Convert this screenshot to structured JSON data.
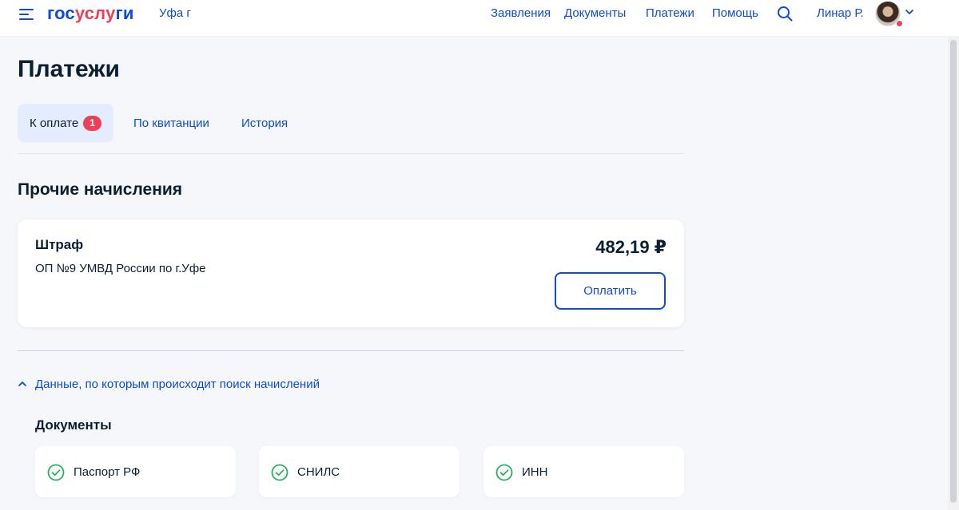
{
  "header": {
    "logo_part1": "гос",
    "logo_part2": "услу",
    "logo_part3": "ги",
    "city": "Уфа г",
    "nav": [
      "Заявления",
      "Документы",
      "Платежи",
      "Помощь"
    ],
    "user_name": "Линар Р."
  },
  "page": {
    "title": "Платежи",
    "tabs": [
      {
        "label": "К оплате",
        "badge": "1"
      },
      {
        "label": "По квитанции"
      },
      {
        "label": "История"
      }
    ]
  },
  "charges": {
    "section_title": "Прочие начисления",
    "item": {
      "title": "Штраф",
      "issuer": "ОП №9 УМВД России по г.Уфе",
      "amount": "482,19 ₽",
      "pay_label": "Оплатить"
    }
  },
  "search_data": {
    "toggle_label": "Данные, по которым происходит поиск начислений",
    "docs_title": "Документы",
    "documents": [
      "Паспорт РФ",
      "СНИЛС",
      "ИНН"
    ]
  },
  "colors": {
    "accent": "#0d4cd3",
    "brand_red": "#ee3f58",
    "success": "#2bb261"
  }
}
